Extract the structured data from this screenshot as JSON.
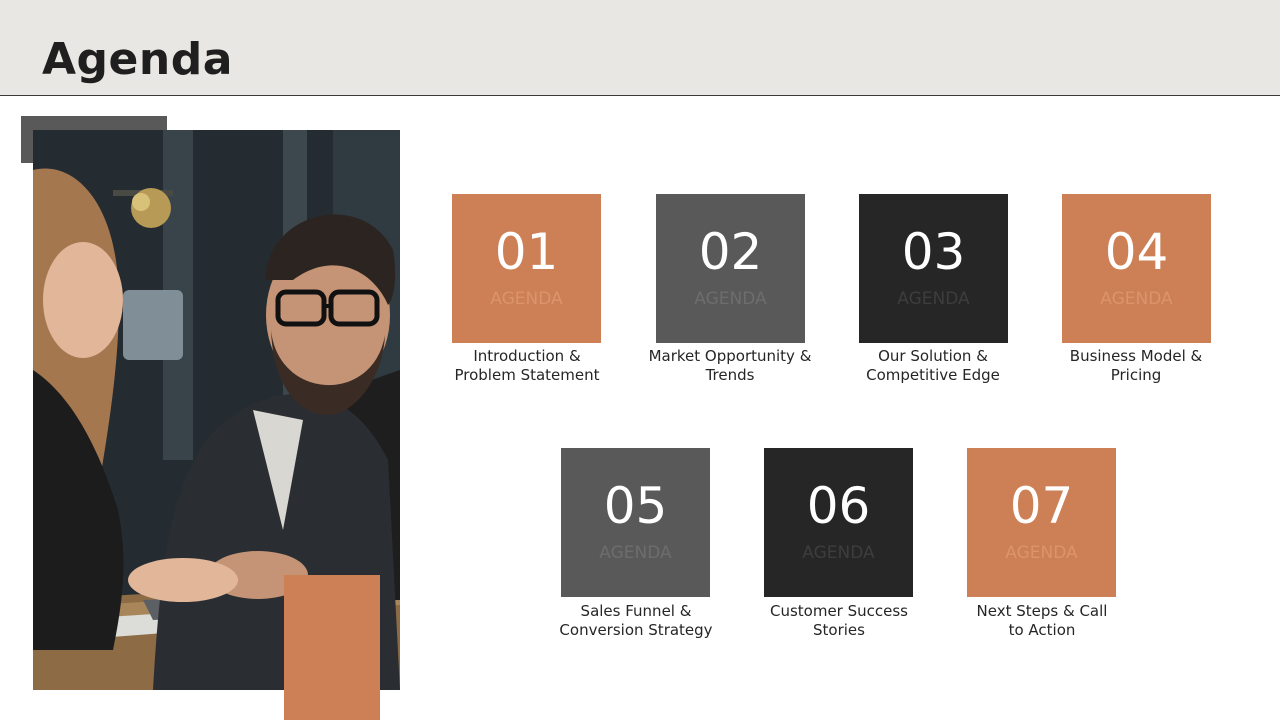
{
  "header": {
    "title": "Agenda"
  },
  "colors": {
    "orange": "#cd7f55",
    "gray": "#595959",
    "dark": "#262626",
    "header_bg": "#e9e7e3"
  },
  "image": {
    "subject": "photo-two-colleagues-at-laptop"
  },
  "agenda": [
    {
      "number": "01",
      "label": "AGENDA",
      "line1": "Introduction &",
      "line2": "Problem Statement",
      "style": "orange"
    },
    {
      "number": "02",
      "label": "AGENDA",
      "line1": "Market Opportunity &",
      "line2": "Trends",
      "style": "gray"
    },
    {
      "number": "03",
      "label": "AGENDA",
      "line1": "Our Solution &",
      "line2": "Competitive Edge",
      "style": "dark"
    },
    {
      "number": "04",
      "label": "AGENDA",
      "line1": "Business Model &",
      "line2": "Pricing",
      "style": "orange"
    },
    {
      "number": "05",
      "label": "AGENDA",
      "line1": "Sales Funnel &",
      "line2": "Conversion Strategy",
      "style": "gray"
    },
    {
      "number": "06",
      "label": "AGENDA",
      "line1": "Customer Success",
      "line2": "Stories",
      "style": "dark"
    },
    {
      "number": "07",
      "label": "AGENDA",
      "line1": "Next Steps & Call",
      "line2": "to Action",
      "style": "orange"
    }
  ]
}
